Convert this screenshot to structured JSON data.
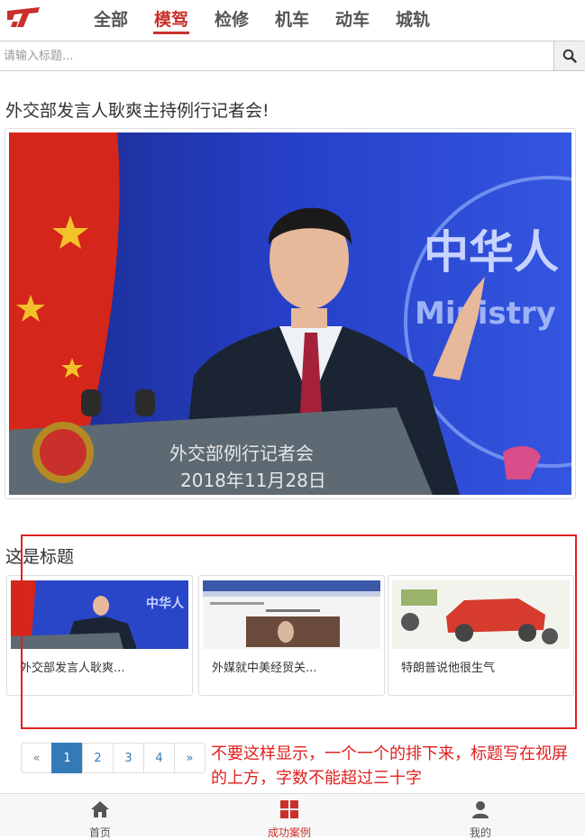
{
  "colors": {
    "accent": "#c9302c",
    "annotation": "#e02020",
    "pager_active": "#337ab7"
  },
  "nav": {
    "logo_icon": "tt-logo-icon",
    "tabs": [
      {
        "label": "全部"
      },
      {
        "label": "模驾",
        "active": true
      },
      {
        "label": "检修"
      },
      {
        "label": "机车"
      },
      {
        "label": "动车"
      },
      {
        "label": "城轨"
      }
    ]
  },
  "search": {
    "placeholder": "请输入标题...",
    "icon": "search-icon"
  },
  "main": {
    "headline": "外交部发言人耿爽主持例行记者会!",
    "hero": {
      "overlay_line1": "外交部例行记者会",
      "overlay_line2": "2018年11月28日",
      "sign_text": "中华人",
      "sign_sub": "Ministry"
    }
  },
  "section": {
    "title": "这是标题",
    "cards": [
      {
        "caption": "外交部发言人耿爽...",
        "thumb_label": "中华人"
      },
      {
        "caption": "外媒就中美经贸关...",
        "thumb_label": ""
      },
      {
        "caption": "特朗普说他很生气",
        "thumb_label": ""
      }
    ]
  },
  "pagination": {
    "prev": "«",
    "pages": [
      "1",
      "2",
      "3",
      "4"
    ],
    "active_page": "1",
    "next": "»"
  },
  "annotation": {
    "text": "不要这样显示，一个一个的排下来，标题写在视屏的上方，字数不能超过三十字"
  },
  "bottom_nav": [
    {
      "label": "首页",
      "icon": "home-icon"
    },
    {
      "label": "成功案例",
      "icon": "grid-icon",
      "active": true
    },
    {
      "label": "我的",
      "icon": "user-icon"
    }
  ]
}
